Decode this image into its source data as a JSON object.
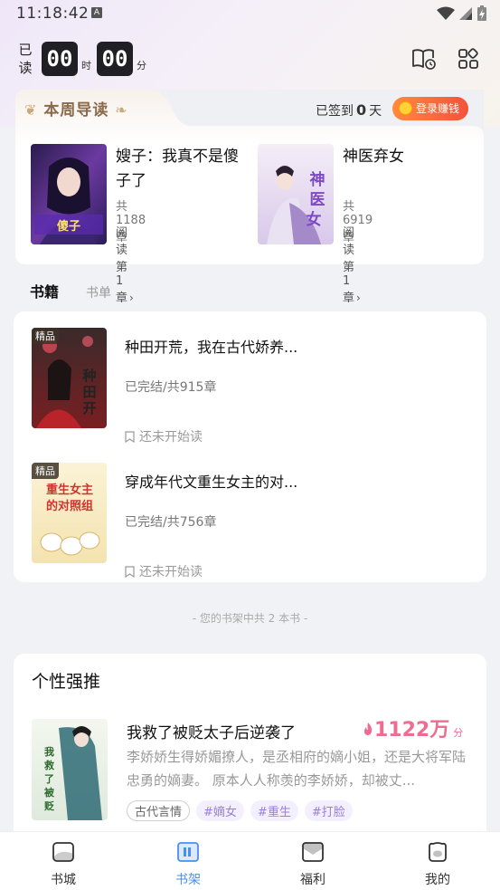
{
  "status_bar": {
    "time": "11:18:42",
    "notif_badge": "A"
  },
  "reading_timer": {
    "label": "已读",
    "hours": "00",
    "hours_unit": "时",
    "minutes": "00",
    "minutes_unit": "分"
  },
  "header_icons": [
    "read-history-icon",
    "grid-apps-icon"
  ],
  "weekly_guide": {
    "title": "本周导读",
    "signin_prefix": "已签到",
    "signin_days": "0",
    "signin_suffix": "天",
    "earn_button": "登录赚钱",
    "books": [
      {
        "title": "嫂子：我真不是傻子了",
        "chapters": "共1188章",
        "read_link": "阅读第1章"
      },
      {
        "title": "神医弃女",
        "chapters": "共6919章",
        "read_link": "阅读第1章"
      }
    ]
  },
  "tabs": {
    "active": "书籍",
    "inactive": "书单"
  },
  "shelf": {
    "items": [
      {
        "badge": "精品",
        "title": "种田开荒，我在古代娇养...",
        "status": "已完结/共915章",
        "progress": "还未开始读"
      },
      {
        "badge": "精品",
        "title": "穿成年代文重生女主的对...",
        "status": "已完结/共756章",
        "progress": "还未开始读"
      }
    ],
    "count_text": "- 您的书架中共 2 本书 -"
  },
  "recommend": {
    "heading": "个性强推",
    "title": "我救了被贬太子后逆袭了",
    "score": "1122万",
    "score_unit": "分",
    "description": "李娇娇生得娇媚撩人，是丞相府的嫡小姐，还是大将军陆忠勇的嫡妻。 原本人人称羡的李娇娇，却被丈...",
    "tag_main": "古代言情",
    "tags": [
      "#嫡女",
      "#重生",
      "#打脸"
    ]
  },
  "bottom_nav": [
    {
      "label": "书城",
      "icon": "bookstore-icon"
    },
    {
      "label": "书架",
      "icon": "bookshelf-icon"
    },
    {
      "label": "福利",
      "icon": "welfare-icon"
    },
    {
      "label": "我的",
      "icon": "profile-icon"
    }
  ],
  "colors": {
    "accent": "#4a8ef0",
    "score_pink": "#f06b8f",
    "earn_orange": "#f5513b"
  }
}
